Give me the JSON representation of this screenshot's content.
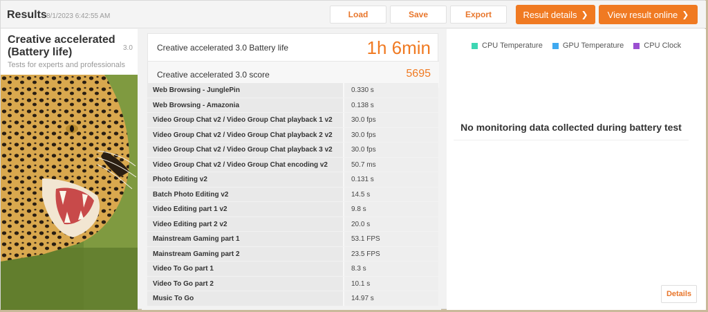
{
  "header": {
    "title": "Results",
    "timestamp": "8/1/2023 6:42:55 AM",
    "load_label": "Load",
    "save_label": "Save",
    "export_label": "Export",
    "result_details_label": "Result details",
    "view_online_label": "View result online"
  },
  "benchmark": {
    "name": "Creative accelerated (Battery life)",
    "version": "3.0",
    "subtitle": "Tests for experts and professionals"
  },
  "summary": {
    "battery_label": "Creative accelerated 3.0 Battery life",
    "battery_value": "1h 6min",
    "score_label": "Creative accelerated 3.0 score",
    "score_value": "5695"
  },
  "tests": [
    {
      "name": "Web Browsing - JunglePin",
      "value": "0.330 s"
    },
    {
      "name": "Web Browsing - Amazonia",
      "value": "0.138 s"
    },
    {
      "name": "Video Group Chat v2 / Video Group Chat playback 1 v2",
      "value": "30.0 fps"
    },
    {
      "name": "Video Group Chat v2 / Video Group Chat playback 2 v2",
      "value": "30.0 fps"
    },
    {
      "name": "Video Group Chat v2 / Video Group Chat playback 3 v2",
      "value": "30.0 fps"
    },
    {
      "name": "Video Group Chat v2 / Video Group Chat encoding v2",
      "value": "50.7 ms"
    },
    {
      "name": "Photo Editing v2",
      "value": "0.131 s"
    },
    {
      "name": "Batch Photo Editing v2",
      "value": "14.5 s"
    },
    {
      "name": "Video Editing part 1 v2",
      "value": "9.8 s"
    },
    {
      "name": "Video Editing part 2 v2",
      "value": "20.0 s"
    },
    {
      "name": "Mainstream Gaming part 1",
      "value": "53.1 FPS"
    },
    {
      "name": "Mainstream Gaming part 2",
      "value": "23.5 FPS"
    },
    {
      "name": "Video To Go part 1",
      "value": "8.3 s"
    },
    {
      "name": "Video To Go part 2",
      "value": "10.1 s"
    },
    {
      "name": "Music To Go",
      "value": "14.97 s"
    }
  ],
  "monitoring": {
    "legend": [
      {
        "label": "CPU Temperature",
        "color": "#3dd6b3"
      },
      {
        "label": "GPU Temperature",
        "color": "#3fa9f0"
      },
      {
        "label": "CPU Clock",
        "color": "#9b4fd1"
      }
    ],
    "no_data_message": "No monitoring data collected during battery test",
    "details_label": "Details"
  },
  "colors": {
    "accent": "#f07a22"
  }
}
